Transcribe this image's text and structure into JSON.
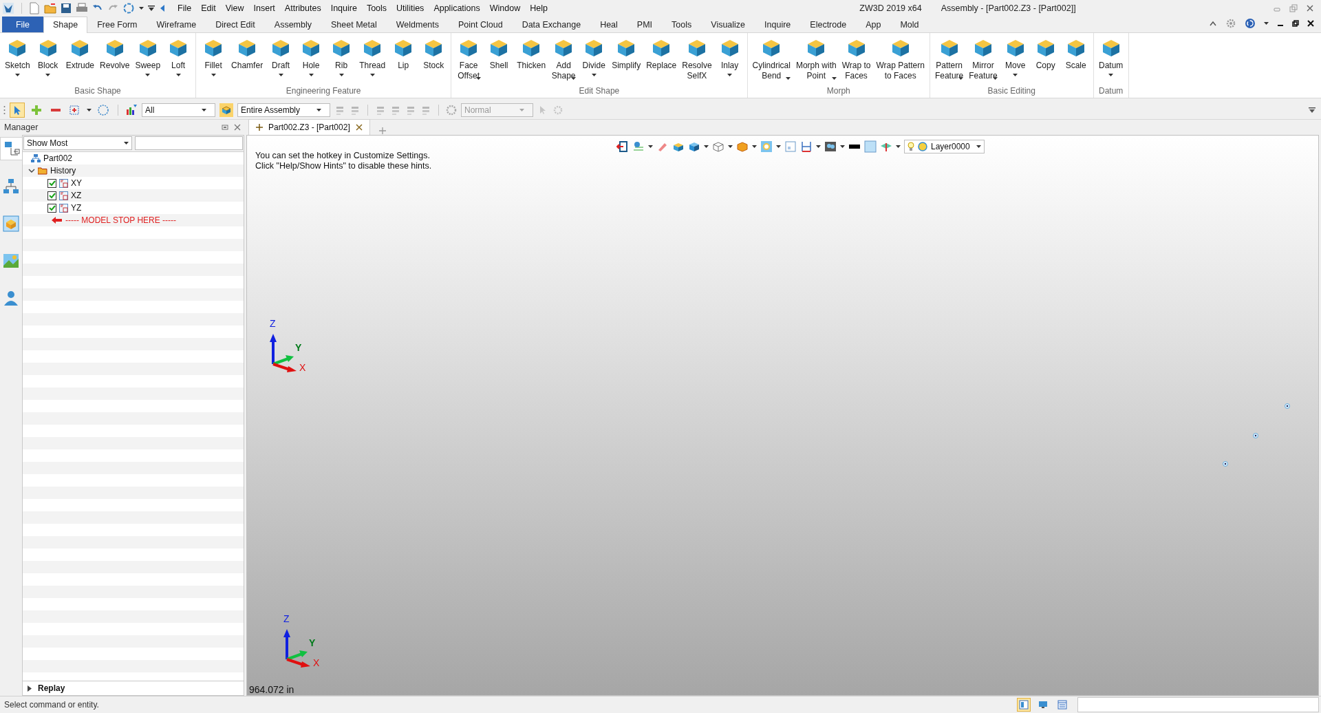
{
  "app_title": "ZW3D 2019  x64",
  "document_title": "Assembly - [Part002.Z3 - [Part002]]",
  "menu": [
    "File",
    "Edit",
    "View",
    "Insert",
    "Attributes",
    "Inquire",
    "Tools",
    "Utilities",
    "Applications",
    "Window",
    "Help"
  ],
  "ribbon_tabs": [
    {
      "label": "File",
      "kind": "file",
      "selected": false
    },
    {
      "label": "Shape",
      "kind": "tab",
      "selected": true
    },
    {
      "label": "Free Form",
      "kind": "tab",
      "selected": false
    },
    {
      "label": "Wireframe",
      "kind": "tab",
      "selected": false
    },
    {
      "label": "Direct Edit",
      "kind": "tab",
      "selected": false
    },
    {
      "label": "Assembly",
      "kind": "tab",
      "selected": false
    },
    {
      "label": "Sheet Metal",
      "kind": "tab",
      "selected": false
    },
    {
      "label": "Weldments",
      "kind": "tab",
      "selected": false
    },
    {
      "label": "Point Cloud",
      "kind": "tab",
      "selected": false
    },
    {
      "label": "Data Exchange",
      "kind": "tab",
      "selected": false
    },
    {
      "label": "Heal",
      "kind": "tab",
      "selected": false
    },
    {
      "label": "PMI",
      "kind": "tab",
      "selected": false
    },
    {
      "label": "Tools",
      "kind": "tab",
      "selected": false
    },
    {
      "label": "Visualize",
      "kind": "tab",
      "selected": false
    },
    {
      "label": "Inquire",
      "kind": "tab",
      "selected": false
    },
    {
      "label": "Electrode",
      "kind": "tab",
      "selected": false
    },
    {
      "label": "App",
      "kind": "tab",
      "selected": false
    },
    {
      "label": "Mold",
      "kind": "tab",
      "selected": false
    }
  ],
  "ribbon_groups": [
    {
      "label": "Basic Shape",
      "buttons": [
        {
          "label": "Sketch",
          "dropdown": true
        },
        {
          "label": "Block",
          "dropdown": true
        },
        {
          "label": "Extrude",
          "dropdown": false
        },
        {
          "label": "Revolve",
          "dropdown": false
        },
        {
          "label": "Sweep",
          "dropdown": true
        },
        {
          "label": "Loft",
          "dropdown": true
        }
      ]
    },
    {
      "label": "Engineering Feature",
      "buttons": [
        {
          "label": "Fillet",
          "dropdown": true
        },
        {
          "label": "Chamfer",
          "dropdown": false
        },
        {
          "label": "Draft",
          "dropdown": true
        },
        {
          "label": "Hole",
          "dropdown": true
        },
        {
          "label": "Rib",
          "dropdown": true
        },
        {
          "label": "Thread",
          "dropdown": true
        },
        {
          "label": "Lip",
          "dropdown": false
        },
        {
          "label": "Stock",
          "dropdown": false
        }
      ]
    },
    {
      "label": "Edit Shape",
      "buttons": [
        {
          "label": "Face\nOffset",
          "dropdown": true
        },
        {
          "label": "Shell",
          "dropdown": false
        },
        {
          "label": "Thicken",
          "dropdown": false
        },
        {
          "label": "Add\nShape",
          "dropdown": true
        },
        {
          "label": "Divide",
          "dropdown": true
        },
        {
          "label": "Simplify",
          "dropdown": false
        },
        {
          "label": "Replace",
          "dropdown": false
        },
        {
          "label": "Resolve\nSelfX",
          "dropdown": false
        },
        {
          "label": "Inlay",
          "dropdown": true
        }
      ]
    },
    {
      "label": "Morph",
      "buttons": [
        {
          "label": "Cylindrical\nBend",
          "dropdown": true
        },
        {
          "label": "Morph with\nPoint",
          "dropdown": true
        },
        {
          "label": "Wrap to\nFaces",
          "dropdown": false
        },
        {
          "label": "Wrap Pattern\nto Faces",
          "dropdown": false
        }
      ]
    },
    {
      "label": "Basic Editing",
      "buttons": [
        {
          "label": "Pattern\nFeature",
          "dropdown": true
        },
        {
          "label": "Mirror\nFeature",
          "dropdown": true
        },
        {
          "label": "Move",
          "dropdown": true
        },
        {
          "label": "Copy",
          "dropdown": false
        },
        {
          "label": "Scale",
          "dropdown": false
        }
      ]
    },
    {
      "label": "Datum",
      "buttons": [
        {
          "label": "Datum",
          "dropdown": true
        }
      ]
    }
  ],
  "toolbar": {
    "tools": [
      {
        "selected": true
      },
      {
        "selected": false
      },
      {
        "selected": false
      },
      {
        "selected": false
      },
      {
        "selected": false
      }
    ],
    "filter": {
      "value": "All"
    },
    "scope": {
      "value": "Entire Assembly"
    },
    "mode": {
      "value": "Normal",
      "disabled": true
    }
  },
  "manager": {
    "title": "Manager",
    "filter": {
      "value": "Show Most"
    },
    "tree": [
      {
        "label": "Part002",
        "kind": "part"
      },
      {
        "label": "History",
        "kind": "folder",
        "expanded": true,
        "children": [
          {
            "label": "XY",
            "kind": "datum",
            "checked": true
          },
          {
            "label": "XZ",
            "kind": "datum",
            "checked": true
          },
          {
            "label": "YZ",
            "kind": "datum",
            "checked": true
          },
          {
            "label": "----- MODEL STOP HERE -----",
            "kind": "stop"
          }
        ]
      }
    ],
    "replay": {
      "label": "Replay",
      "expanded": false
    }
  },
  "document_tab": {
    "label": "Part002.Z3 - [Part002]"
  },
  "viewport": {
    "hints": [
      "You can set the hotkey in Customize Settings.",
      "Click \"Help/Show Hints\" to disable these hints."
    ],
    "layer": {
      "value": "Layer0000"
    },
    "triads": [
      {
        "x": "X",
        "y": "Y",
        "z": "Z"
      },
      {
        "x": "X",
        "y": "Y",
        "z": "Z"
      }
    ],
    "scale": "964.072 in"
  },
  "status_bar": {
    "message": "Select command or entity.",
    "view_modes": [
      {
        "selected": true
      },
      {
        "selected": false
      },
      {
        "selected": false
      }
    ]
  }
}
